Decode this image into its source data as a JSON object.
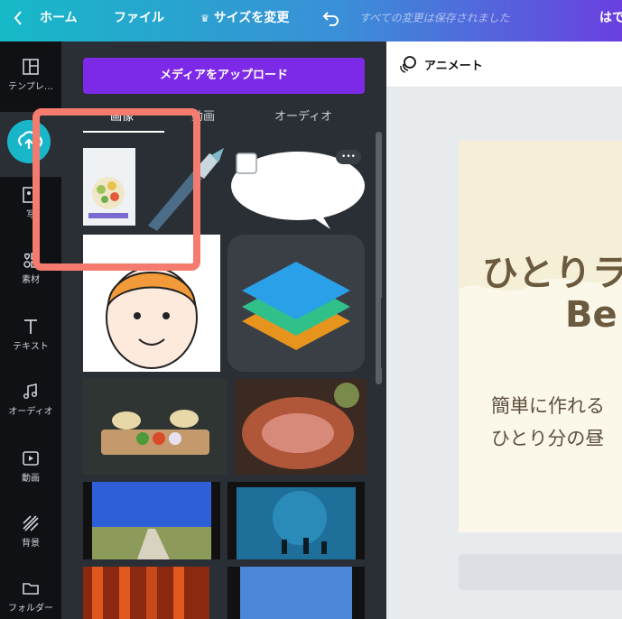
{
  "topbar": {
    "home": "ホーム",
    "file": "ファイル",
    "resize": "サイズを変更",
    "saved_status": "すべての変更は保存されました",
    "right_cut": "はで"
  },
  "rail": {
    "items": [
      {
        "label": "テンプレ…",
        "icon": "template-icon"
      },
      {
        "label": "",
        "icon": "upload-cloud-icon"
      },
      {
        "label": "写",
        "icon": "photo-icon"
      },
      {
        "label": "素材",
        "icon": "elements-icon"
      },
      {
        "label": "テキスト",
        "icon": "text-icon"
      },
      {
        "label": "オーディオ",
        "icon": "music-icon"
      },
      {
        "label": "動画",
        "icon": "video-icon"
      },
      {
        "label": "背景",
        "icon": "background-icon"
      },
      {
        "label": "フォルダー",
        "icon": "folder-icon"
      }
    ]
  },
  "panel": {
    "upload_label": "メディアをアップロード",
    "tabs": [
      "画像",
      "動画",
      "オーディオ"
    ],
    "more_label": "•••"
  },
  "canvas": {
    "animate_label": "アニメート",
    "page_title_1": "ひとりラ",
    "page_title_2": "Be",
    "page_sub_1": "簡単に作れる",
    "page_sub_2": "ひとり分の昼"
  },
  "colors": {
    "accent": "#7d2ae8",
    "teal": "#19b6c9",
    "highlight": "#f47b6e",
    "title_brown": "#6b5a3e"
  }
}
